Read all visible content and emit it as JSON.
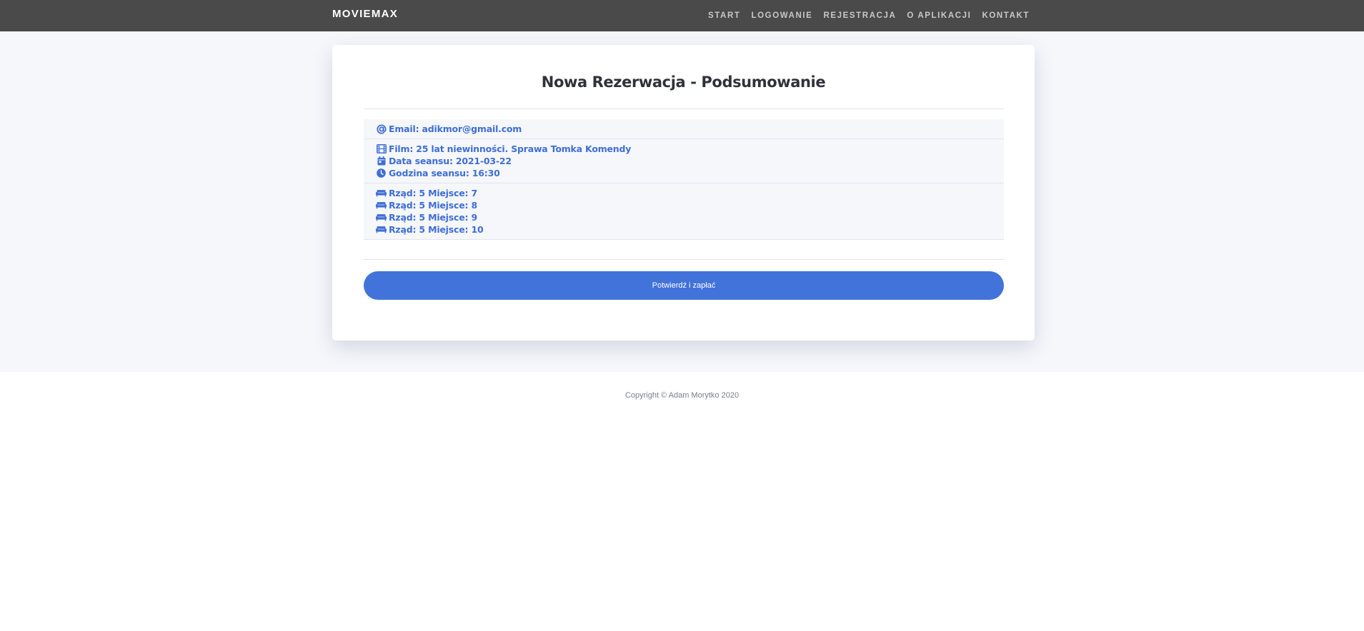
{
  "nav": {
    "brand": "MOVIEMAX",
    "links": [
      "START",
      "LOGOWANIE",
      "REJESTRACJA",
      "O APLIKACJI",
      "KONTAKT"
    ]
  },
  "summary": {
    "title": "Nowa Rezerwacja - Podsumowanie",
    "email": "Email: adikmor@gmail.com",
    "film": "Film: 25 lat niewinności. Sprawa Tomka Komendy",
    "date": "Data seansu: 2021-03-22",
    "time": "Godzina seansu: 16:30",
    "seats": [
      "Rząd: 5 Miejsce: 7",
      "Rząd: 5 Miejsce: 8",
      "Rząd: 5 Miejsce: 9",
      "Rząd: 5 Miejsce: 10"
    ],
    "confirm_label": "Potwierdź i zapłać"
  },
  "icons": {
    "email": "at-icon",
    "film": "film-icon",
    "date": "calendar-icon",
    "time": "clock-icon",
    "seat": "couch-icon"
  },
  "colors": {
    "navbar": "#4a4a4a",
    "accent": "#4273db",
    "text_accent": "#3f6ed6",
    "page_bg": "#f5f7fb"
  },
  "footer": {
    "copyright": "Copyright © Adam Morytko 2020"
  }
}
